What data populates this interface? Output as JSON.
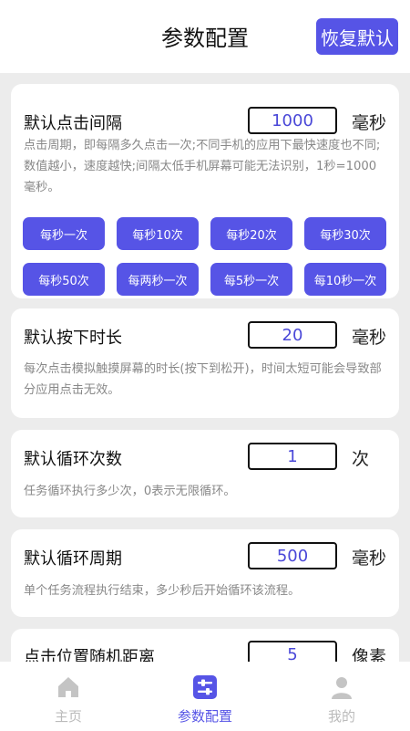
{
  "header": {
    "title": "参数配置",
    "reset_label": "恢复默认"
  },
  "cards": {
    "click_interval": {
      "title": "默认点击间隔",
      "value": "1000",
      "unit": "毫秒",
      "desc": "点击周期，即每隔多久点击一次;不同手机的应用下最快速度也不同;数值越小，速度越快;间隔太低手机屏幕可能无法识别，1秒=1000毫秒。",
      "presets": [
        "每秒一次",
        "每秒10次",
        "每秒20次",
        "每秒30次",
        "每秒50次",
        "每两秒一次",
        "每5秒一次",
        "每10秒一次"
      ]
    },
    "press_duration": {
      "title": "默认按下时长",
      "value": "20",
      "unit": "毫秒",
      "desc": "每次点击模拟触摸屏幕的时长(按下到松开)，时间太短可能会导致部分应用点击无效。"
    },
    "loop_count": {
      "title": "默认循环次数",
      "value": "1",
      "unit": "次",
      "desc": "任务循环执行多少次，0表示无限循环。"
    },
    "loop_period": {
      "title": "默认循环周期",
      "value": "500",
      "unit": "毫秒",
      "desc": "单个任务流程执行结束，多少秒后开始循环该流程。"
    },
    "random_distance": {
      "title": "点击位置随机距离",
      "value": "5",
      "unit": "像素"
    }
  },
  "tabbar": {
    "home": "主页",
    "config": "参数配置",
    "mine": "我的"
  },
  "colors": {
    "accent": "#5654e6",
    "inactive": "#bbbbbb",
    "background": "#ececec"
  },
  "icons": {
    "home": "home-icon",
    "config": "sliders-icon",
    "mine": "user-icon"
  }
}
